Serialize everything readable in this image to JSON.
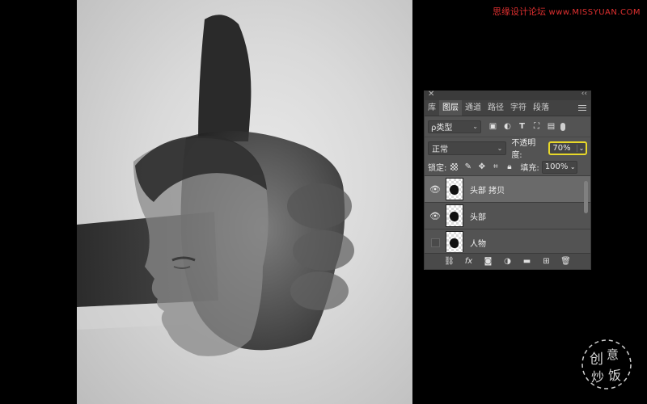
{
  "watermark": {
    "text": "思缘设计论坛",
    "site": "www.MISSYUAN.COM"
  },
  "logo": {
    "chars": "创意炒饭"
  },
  "panel": {
    "close_icon": "close-icon",
    "collapse_icon": "collapse-icon",
    "tabs": [
      {
        "label": "库",
        "active": false
      },
      {
        "label": "图层",
        "active": true
      },
      {
        "label": "通道",
        "active": false
      },
      {
        "label": "路径",
        "active": false
      },
      {
        "label": "字符",
        "active": false
      },
      {
        "label": "段落",
        "active": false
      }
    ],
    "filter": {
      "kind_label": "ρ类型",
      "icons": [
        "image-filter-icon",
        "adjustment-filter-icon",
        "type-filter-icon",
        "shape-filter-icon",
        "smart-object-filter-icon"
      ]
    },
    "blend_mode": "正常",
    "opacity_label": "不透明度:",
    "opacity_value": "70%",
    "lock_label": "锁定:",
    "fill_label": "填充:",
    "fill_value": "100%",
    "layers": [
      {
        "name": "头部 拷贝",
        "visible": true,
        "selected": true
      },
      {
        "name": "头部",
        "visible": true,
        "selected": false
      },
      {
        "name": "人物",
        "visible": false,
        "selected": false
      }
    ],
    "bottom_icons": [
      "link-icon",
      "fx-icon",
      "mask-icon",
      "adjustment-icon",
      "folder-icon",
      "new-layer-icon",
      "trash-icon"
    ],
    "fx_label": "fx"
  },
  "colors": {
    "opacity_highlight": "#e8d82a",
    "panel_bg": "#535353",
    "watermark": "#e03030"
  }
}
